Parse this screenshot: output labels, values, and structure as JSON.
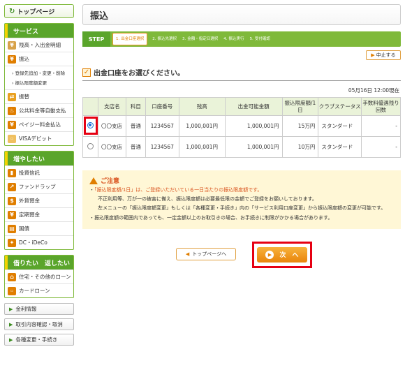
{
  "sidebar": {
    "top_page": "トップページ",
    "service_title": "サービス",
    "service_items": [
      "残高・入出金明細",
      "振込",
      "振替",
      "公共料金等自動支払",
      "ペイジー料金払込",
      "VISAデビット"
    ],
    "service_subs": [
      "登録先追加・変更・削除",
      "振込限度額変更"
    ],
    "invest_title": "増やしたい",
    "invest_items": [
      "投資信託",
      "ファンドラップ",
      "外貨預金",
      "定期預金",
      "国債",
      "DC・iDeCo"
    ],
    "loan_title": "借りたい　返したい",
    "loan_items": [
      "住宅・その他のローン",
      "カードローン"
    ],
    "links": [
      "金利情報",
      "取引内容確認・取消",
      "各種変更・手続き"
    ]
  },
  "main": {
    "title": "振込",
    "step_label": "STEP",
    "steps": [
      {
        "num": "1.",
        "label": "出金口座選択"
      },
      {
        "num": "2.",
        "label": "振込先選択"
      },
      {
        "num": "3.",
        "label": "金額・指定日選択"
      },
      {
        "num": "4.",
        "label": "振込実行"
      },
      {
        "num": "5.",
        "label": "受付確認"
      }
    ],
    "cancel": "中止する",
    "section_title": "出金口座をお選びください。",
    "timestamp": "05月16日 12:00現在",
    "table": {
      "headers": [
        "",
        "支店名",
        "科目",
        "口座番号",
        "残高",
        "出金可能金額",
        "振込限度額/1日",
        "クラブステータス",
        "手数料優遇残り回数"
      ],
      "rows": [
        [
          "",
          "〇〇支店",
          "普通",
          "1234567",
          "1,000,001円",
          "1,000,001円",
          "15万円",
          "スタンダード",
          "-"
        ],
        [
          "",
          "〇〇支店",
          "普通",
          "1234567",
          "1,000,001円",
          "1,000,001円",
          "10万円",
          "スタンダード",
          "-"
        ]
      ]
    },
    "notice": {
      "title": "ご注意",
      "line1_hl": "「振込限度額/1日」は、ご登録いただいている一日当たりの振込限度額です。",
      "line2": "不正利用等、万が一の被害に備え、振込限度額は必要最低限の金額でご登録をお願いしております。",
      "line3": "左メニューの「振込限度額変更」もしくは「各種変更・手続き」内の「サービス利用口座変更」から振込限度額の変更が可能です。",
      "line4": "・振込限度額の範囲内であっても、一定金額以上のお取引きの場合、お手続きに制限がかかる場合があります。"
    },
    "top_page_btn": "トップページへ",
    "next_btn": "次　へ"
  }
}
